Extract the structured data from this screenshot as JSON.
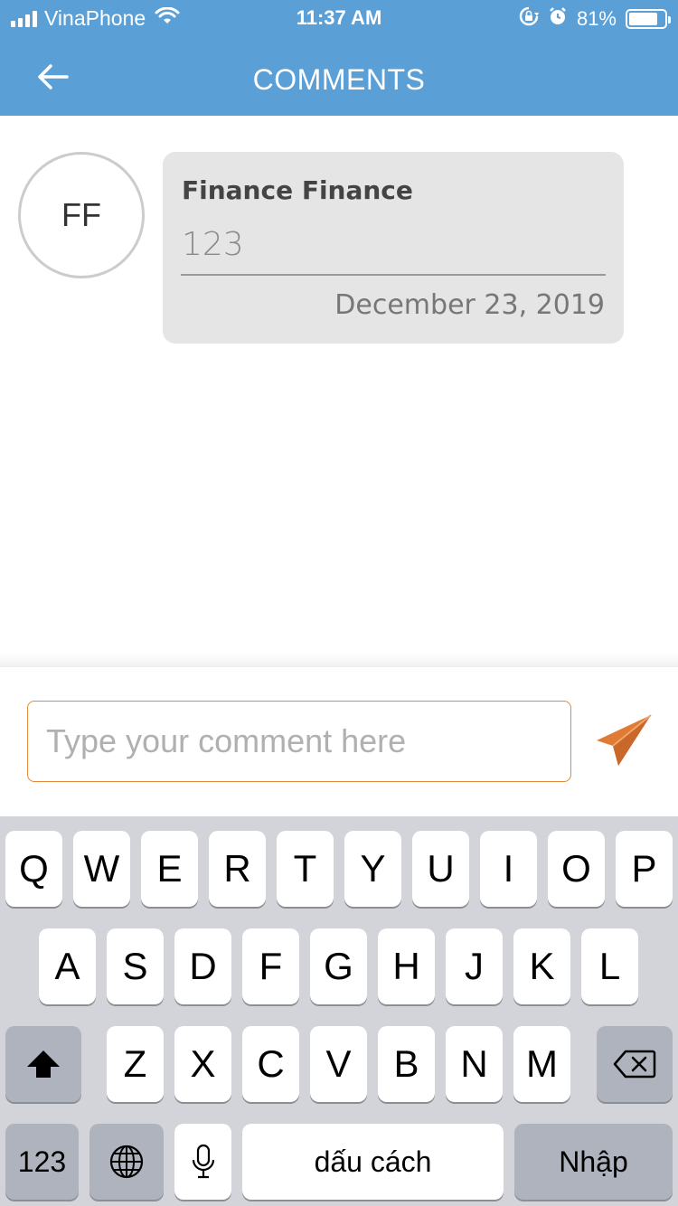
{
  "status": {
    "carrier": "VinaPhone",
    "time": "11:37 AM",
    "battery_percent": "81%",
    "battery_level": 0.81,
    "signal_bars": 4,
    "wifi_icon": "wifi-icon",
    "lock_icon": "rotation-lock-icon",
    "alarm_icon": "alarm-icon"
  },
  "header": {
    "title": "COMMENTS",
    "back_icon": "arrow-left-icon",
    "background_color": "#5a9fd6"
  },
  "comments": [
    {
      "initials": "FF",
      "author": "Finance Finance",
      "text": "123",
      "date": "December 23, 2019"
    }
  ],
  "composer": {
    "placeholder": "Type your comment here",
    "value": "",
    "send_icon": "paper-plane-icon",
    "accent_color": "#e07b33"
  },
  "keyboard": {
    "row1": [
      "Q",
      "W",
      "E",
      "R",
      "T",
      "Y",
      "U",
      "I",
      "O",
      "P"
    ],
    "row2": [
      "A",
      "S",
      "D",
      "F",
      "G",
      "H",
      "J",
      "K",
      "L"
    ],
    "row3": [
      "Z",
      "X",
      "C",
      "V",
      "B",
      "N",
      "M"
    ],
    "shift_icon": "shift-icon",
    "backspace_icon": "backspace-icon",
    "numbers_label": "123",
    "globe_icon": "globe-icon",
    "mic_icon": "microphone-icon",
    "space_label": "dấu cách",
    "return_label": "Nhập"
  }
}
